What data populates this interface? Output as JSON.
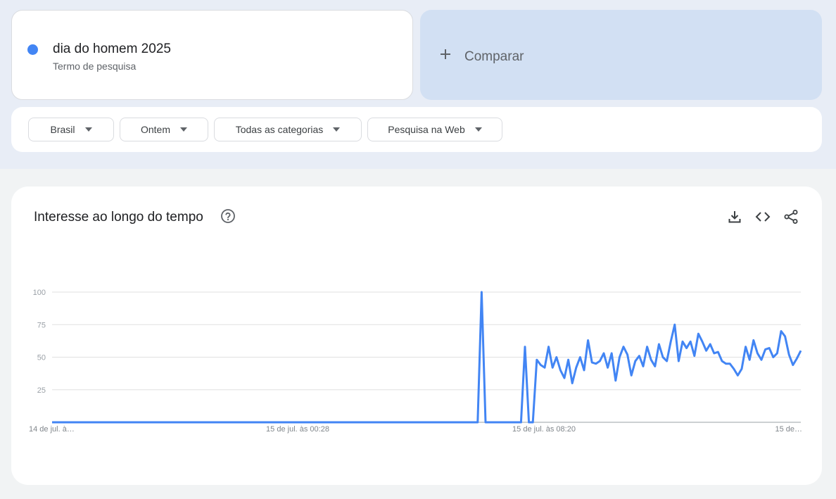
{
  "search_term": {
    "name": "dia do homem 2025",
    "type": "Termo de pesquisa",
    "color": "#4285f4"
  },
  "compare": {
    "label": "Comparar"
  },
  "filters": [
    {
      "label": "Brasil"
    },
    {
      "label": "Ontem"
    },
    {
      "label": "Todas as categorias"
    },
    {
      "label": "Pesquisa na Web"
    }
  ],
  "chart_panel": {
    "title": "Interesse ao longo do tempo",
    "help_icon": "help-circle-icon",
    "actions": [
      "download-icon",
      "embed-code-icon",
      "share-icon"
    ]
  },
  "chart_data": {
    "type": "line",
    "ylim": [
      0,
      100
    ],
    "y_ticks": [
      "100",
      "75",
      "50",
      "25"
    ],
    "x_tick_labels": [
      "14 de jul. à…",
      "15 de jul. às 00:28",
      "15 de jul. às 08:20",
      "15 de…"
    ],
    "grid": true,
    "series": [
      {
        "color": "#4285f4",
        "values": [
          0,
          0,
          0,
          0,
          0,
          0,
          0,
          0,
          0,
          0,
          0,
          0,
          0,
          0,
          0,
          0,
          0,
          0,
          0,
          0,
          0,
          0,
          0,
          0,
          0,
          0,
          0,
          0,
          0,
          0,
          0,
          0,
          0,
          0,
          0,
          0,
          0,
          0,
          0,
          0,
          0,
          0,
          0,
          0,
          0,
          0,
          0,
          0,
          0,
          0,
          0,
          0,
          0,
          0,
          0,
          0,
          0,
          0,
          0,
          0,
          0,
          0,
          0,
          0,
          0,
          0,
          0,
          0,
          0,
          0,
          0,
          0,
          0,
          0,
          0,
          0,
          0,
          0,
          0,
          0,
          0,
          0,
          0,
          0,
          0,
          0,
          0,
          0,
          0,
          0,
          0,
          0,
          0,
          0,
          0,
          0,
          0,
          0,
          0,
          0,
          0,
          0,
          0,
          0,
          0,
          0,
          0,
          0,
          0,
          100,
          0,
          0,
          0,
          0,
          0,
          0,
          0,
          0,
          0,
          0,
          58,
          0,
          0,
          48,
          44,
          42,
          58,
          42,
          50,
          40,
          34,
          48,
          30,
          42,
          50,
          40,
          63,
          46,
          45,
          47,
          53,
          42,
          53,
          32,
          50,
          58,
          52,
          36,
          47,
          51,
          43,
          58,
          48,
          43,
          60,
          50,
          47,
          62,
          75,
          47,
          62,
          57,
          62,
          51,
          68,
          62,
          55,
          60,
          53,
          54,
          47,
          45,
          45,
          41,
          36,
          41,
          58,
          48,
          63,
          53,
          48,
          56,
          57,
          50,
          53,
          70,
          66,
          52,
          44,
          49,
          55
        ]
      }
    ]
  }
}
